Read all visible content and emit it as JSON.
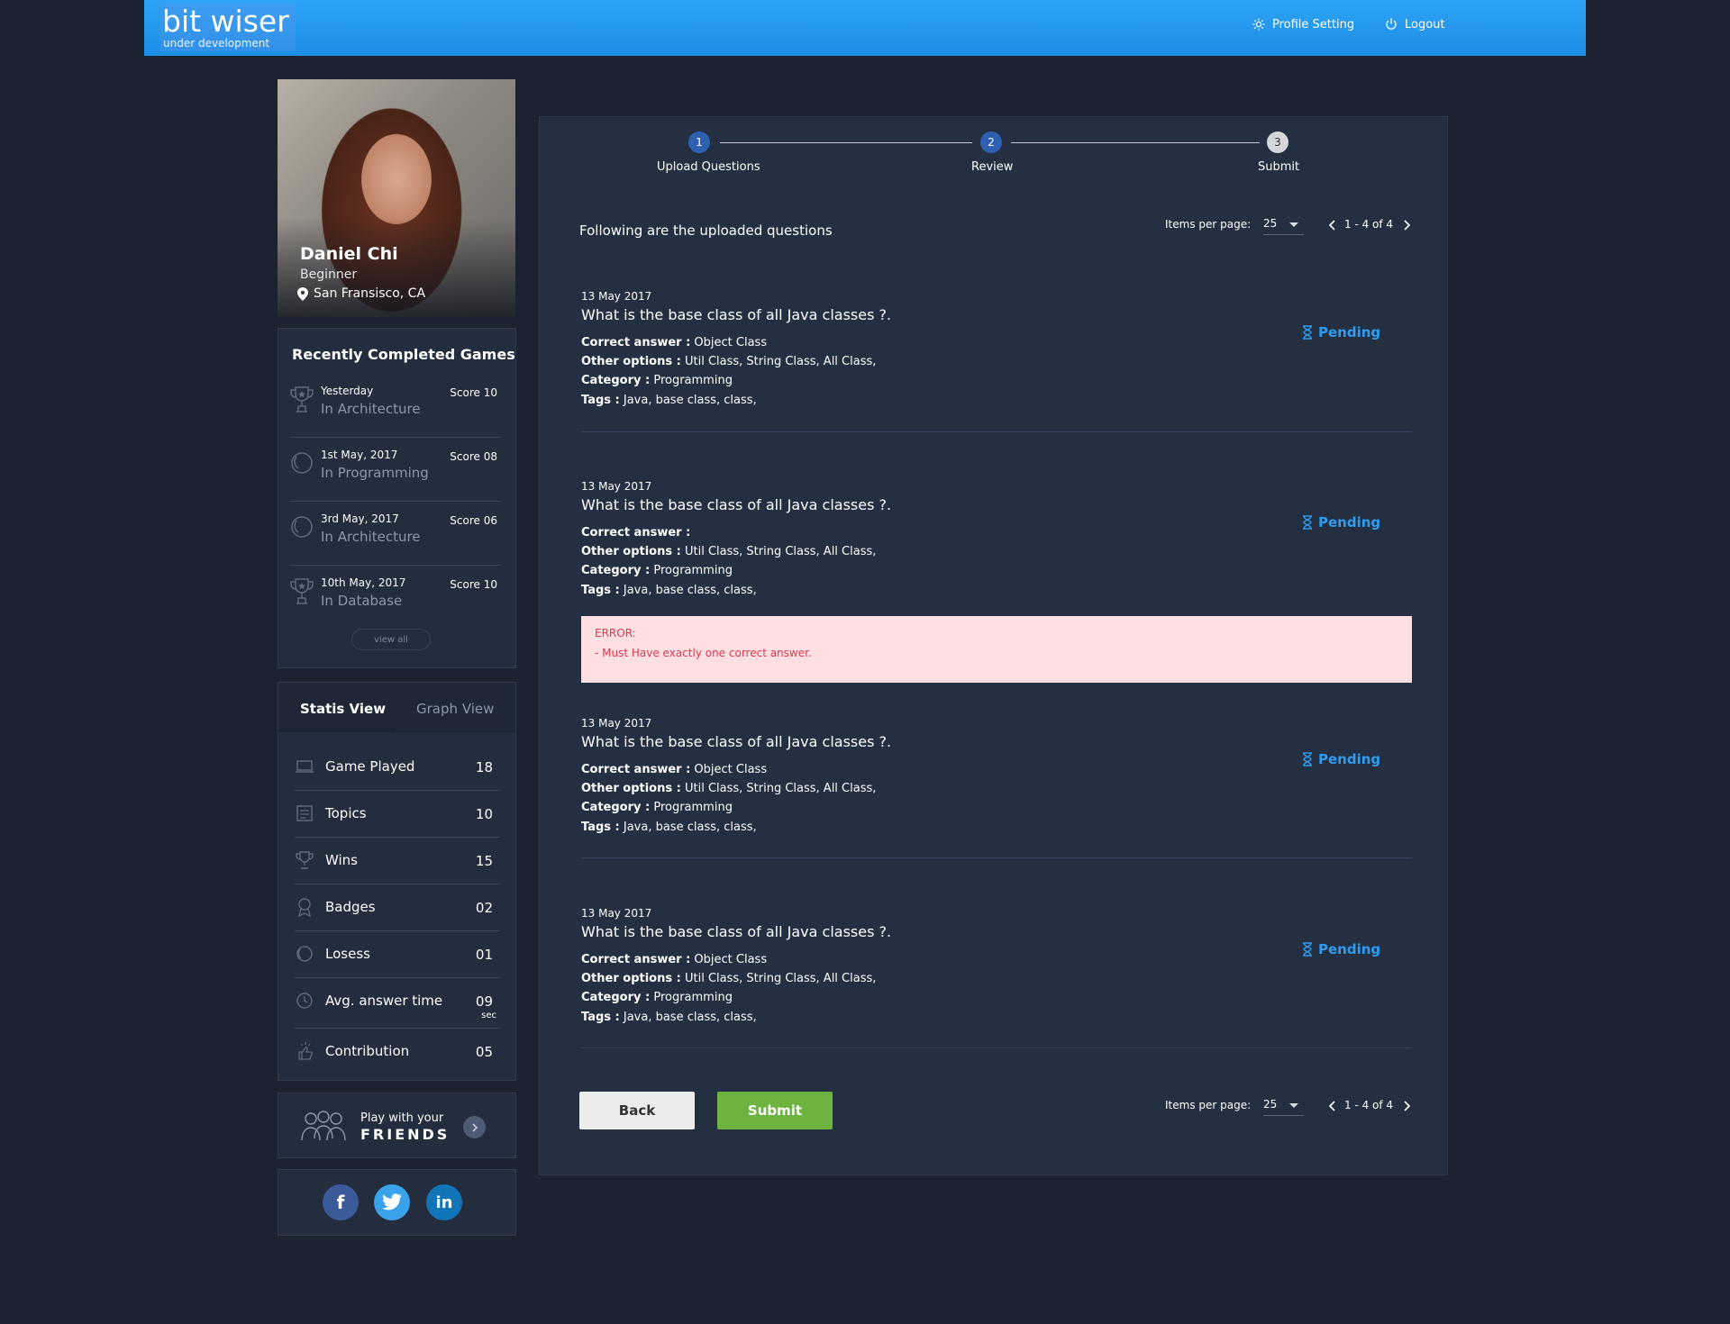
{
  "header": {
    "logo_main": "bit wiser",
    "logo_sub": "under development",
    "profile_setting": "Profile Setting",
    "logout": "Logout"
  },
  "profile": {
    "name": "Daniel Chi",
    "level": "Beginner",
    "location": "San Fransisco, CA"
  },
  "recent_games": {
    "title": "Recently Completed Games",
    "items": [
      {
        "date": "Yesterday",
        "category": "In Architecture",
        "score": "Score 10",
        "icon": "trophy-icon"
      },
      {
        "date": "1st May, 2017",
        "category": "In Programming",
        "score": "Score 08",
        "icon": "lose-icon"
      },
      {
        "date": "3rd May, 2017",
        "category": "In Architecture",
        "score": "Score 06",
        "icon": "lose-icon"
      },
      {
        "date": "10th May, 2017",
        "category": "In Database",
        "score": "Score 10",
        "icon": "trophy-icon"
      }
    ],
    "view_all": "view all"
  },
  "stats": {
    "tab_static": "Statis View",
    "tab_graph": "Graph View",
    "rows": [
      {
        "label": "Game Played",
        "value": "18",
        "icon": "laptop-icon"
      },
      {
        "label": "Topics",
        "value": "10",
        "icon": "list-icon"
      },
      {
        "label": "Wins",
        "value": "15",
        "icon": "trophy-icon"
      },
      {
        "label": "Badges",
        "value": "02",
        "icon": "badge-icon"
      },
      {
        "label": "Losess",
        "value": "01",
        "icon": "lose-icon"
      },
      {
        "label": "Avg. answer time",
        "value": "09",
        "unit": "sec",
        "icon": "clock-icon"
      },
      {
        "label": "Contribution",
        "value": "05",
        "icon": "contribution-icon"
      }
    ]
  },
  "friends": {
    "line1": "Play with your",
    "line2": "FRIENDS"
  },
  "social": {
    "facebook": "f",
    "linkedin": "in"
  },
  "stepper": {
    "steps": [
      {
        "num": "1",
        "label": "Upload Questions"
      },
      {
        "num": "2",
        "label": "Review"
      },
      {
        "num": "3",
        "label": "Submit"
      }
    ]
  },
  "main": {
    "intro": "Following are the uploaded questions",
    "items_per_page_label": "Items per page:",
    "items_per_page": "25",
    "range": "1 - 4 of 4",
    "back": "Back",
    "submit": "Submit"
  },
  "questions": [
    {
      "date": "13 May 2017",
      "title": "What is the base class of all Java classes ?.",
      "correct_label": "Correct answer :",
      "correct": " Object Class",
      "other_label": "Other options :",
      "other": " Util Class, String Class, All Class,",
      "category_label": "Category :",
      "category": " Programming",
      "tags_label": "Tags :",
      "tags": " Java, base class, class,",
      "status": "Pending"
    },
    {
      "date": "13 May 2017",
      "title": "What is the base class of all Java classes ?.",
      "correct_label": "Correct answer :",
      "correct": "",
      "other_label": "Other options :",
      "other": " Util Class, String Class, All Class,",
      "category_label": "Category :",
      "category": " Programming",
      "tags_label": "Tags :",
      "tags": " Java, base class, class,",
      "status": "Pending",
      "error_title": "ERROR:",
      "error_msg": "- Must Have exactly one correct answer."
    },
    {
      "date": "13 May 2017",
      "title": "What is the base class of all Java classes ?.",
      "correct_label": "Correct answer :",
      "correct": " Object Class",
      "other_label": "Other options :",
      "other": " Util Class, String Class, All Class,",
      "category_label": "Category :",
      "category": " Programming",
      "tags_label": "Tags :",
      "tags": " Java, base class, class,",
      "status": "Pending"
    },
    {
      "date": "13 May 2017",
      "title": "What is the base class of all Java classes ?.",
      "correct_label": "Correct answer :",
      "correct": " Object Class",
      "other_label": "Other options :",
      "other": " Util Class, String Class, All Class,",
      "category_label": "Category :",
      "category": " Programming",
      "tags_label": "Tags :",
      "tags": " Java, base class, class,",
      "status": "Pending"
    }
  ],
  "colors": {
    "header": "#1c8ee6",
    "background": "#1c2230",
    "panel": "#243042",
    "pending": "#2f9cf0",
    "step_active": "#2f5fb0",
    "submit_button": "#6db33f",
    "error_bg": "#ffdfe2",
    "error_text": "#e0394f"
  }
}
